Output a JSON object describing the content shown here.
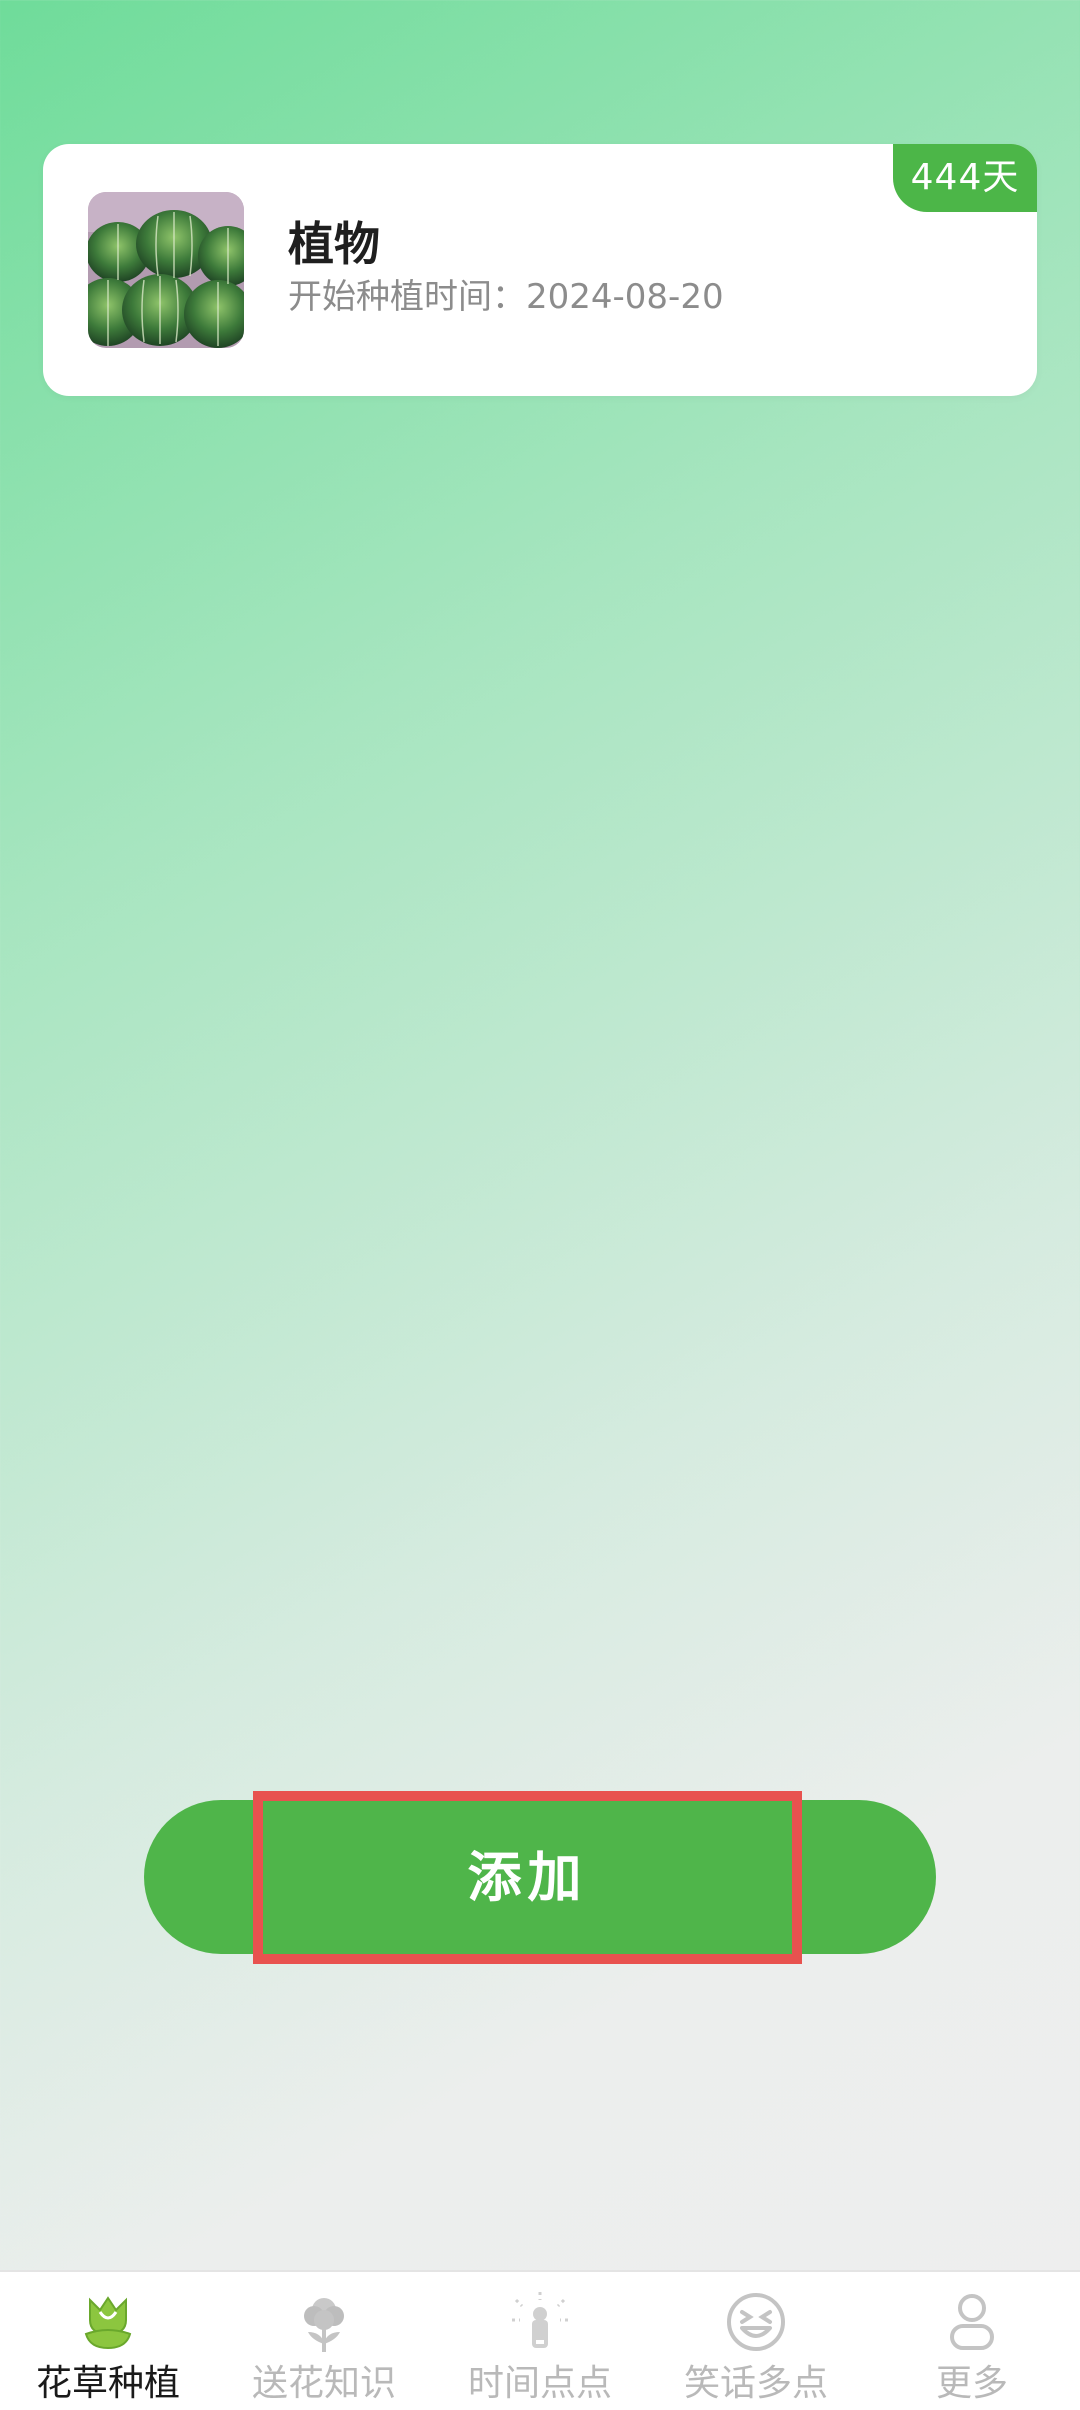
{
  "plant_card": {
    "name": "植物",
    "start_date": "开始种植时间：2024-08-20",
    "days_badge": "444天",
    "thumbnail_icon": "cactus-photo"
  },
  "add_button": {
    "label": "添加"
  },
  "bottom_nav": {
    "items": [
      {
        "label": "花草种植",
        "icon": "tulip-icon",
        "active": true
      },
      {
        "label": "送花知识",
        "icon": "flower-icon",
        "active": false
      },
      {
        "label": "时间点点",
        "icon": "clock-touch-icon",
        "active": false
      },
      {
        "label": "笑话多点",
        "icon": "laugh-face-icon",
        "active": false
      },
      {
        "label": "更多",
        "icon": "person-icon",
        "active": false
      }
    ]
  },
  "colors": {
    "accent": "#4fb54a",
    "highlight_border": "#e8524f"
  }
}
